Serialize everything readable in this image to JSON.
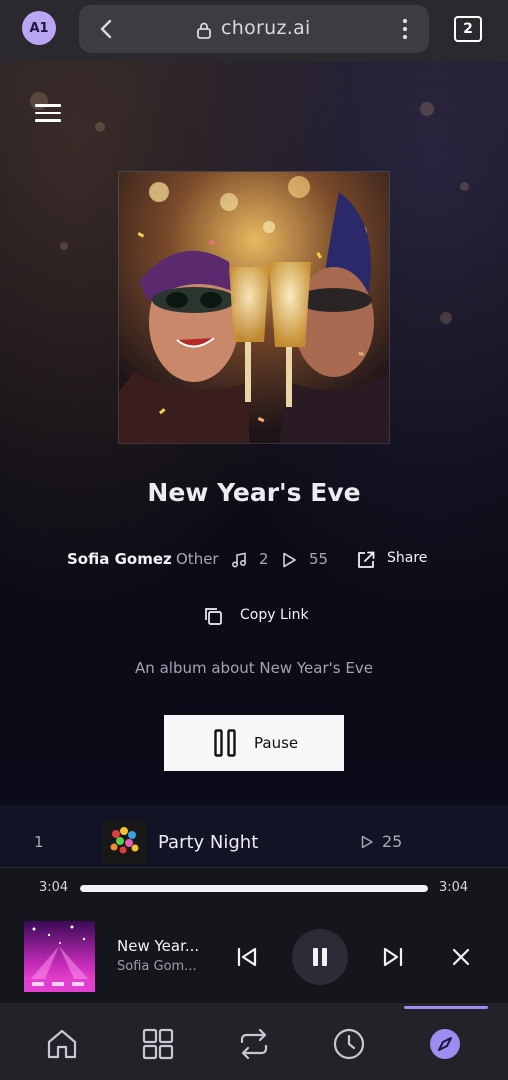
{
  "browser": {
    "profile_badge": "A1",
    "url": "choruz.ai",
    "tab_count": "2"
  },
  "album": {
    "title": "New Year's Eve",
    "artist": "Sofia Gomez",
    "genre": "Other",
    "song_count": "2",
    "play_count": "55",
    "share_label": "Share",
    "copy_link_label": "Copy Link",
    "description": "An album about New Year's Eve",
    "pause_label": "Pause"
  },
  "tracks": [
    {
      "number": "1",
      "title": "Party Night",
      "plays": "25"
    }
  ],
  "player": {
    "elapsed": "3:04",
    "duration": "3:04",
    "progress": 1.0,
    "title": "New Year...",
    "artist": "Sofia Gom..."
  },
  "colors": {
    "accent": "#9d8df1",
    "avatar_bg": "#b9a7f4",
    "button_bg": "#f7f7fa"
  },
  "icons": [
    "back-icon",
    "lock-icon",
    "kebab-menu-icon",
    "hamburger-menu-icon",
    "music-note-icon",
    "play-icon",
    "share-icon",
    "copy-icon",
    "pause-icon",
    "skip-previous-icon",
    "skip-next-icon",
    "close-icon",
    "home-icon",
    "grid-icon",
    "repeat-icon",
    "history-icon",
    "explore-icon"
  ]
}
